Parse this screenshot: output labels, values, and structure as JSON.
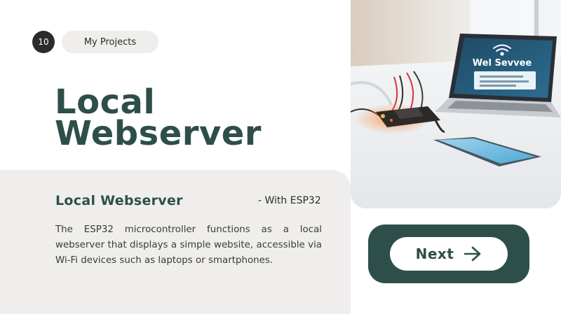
{
  "header": {
    "step_number": "10",
    "section_label": "My Projects"
  },
  "main": {
    "title_line1": "Local",
    "title_line2": "Webserver"
  },
  "card": {
    "title": "Local Webserver",
    "subtitle": "- With ESP32",
    "body": "The ESP32 microcontroller functions as a local webserver that displays a simple website, accessible via Wi-Fi devices such as laptops or smartphones."
  },
  "photo": {
    "laptop_screen_text": "Wel Sevvee"
  },
  "navigation": {
    "next_label": "Next",
    "next_icon": "arrow-right-icon"
  },
  "colors": {
    "accent": "#2e4f49",
    "card_background": "#efeeec",
    "badge": "#2b2b2b"
  }
}
